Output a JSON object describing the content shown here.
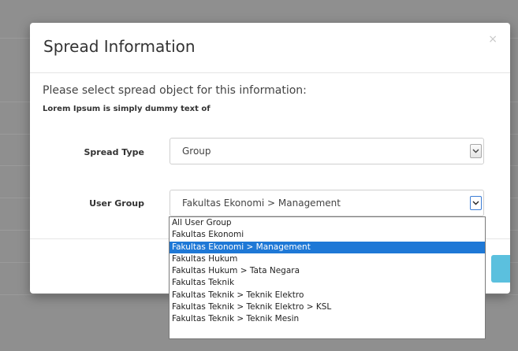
{
  "modal": {
    "title": "Spread Information",
    "close": "×",
    "subtitle": "Please select spread object for this information:",
    "note": "Lorem Ipsum is simply dummy text of"
  },
  "form": {
    "spread_type": {
      "label": "Spread Type",
      "value": "Group"
    },
    "user_group": {
      "label": "User Group",
      "value": "Fakultas Ekonomi > Management"
    }
  },
  "dropdown": {
    "options": [
      "All User Group",
      "Fakultas Ekonomi",
      "Fakultas Ekonomi > Management",
      "Fakultas Hukum",
      "Fakultas Hukum > Tata Negara",
      "Fakultas Teknik",
      "Fakultas Teknik > Teknik Elektro",
      "Fakultas Teknik > Teknik Elektro > KSL",
      "Fakultas Teknik > Teknik Mesin"
    ],
    "selected_index": 2
  },
  "icons": {
    "close": "close-icon",
    "chevron": "chevron-down-icon"
  },
  "colors": {
    "selected_option": "#1e78d6",
    "footer_button": "#5bc0de",
    "overlay": "#8f8f8f"
  }
}
